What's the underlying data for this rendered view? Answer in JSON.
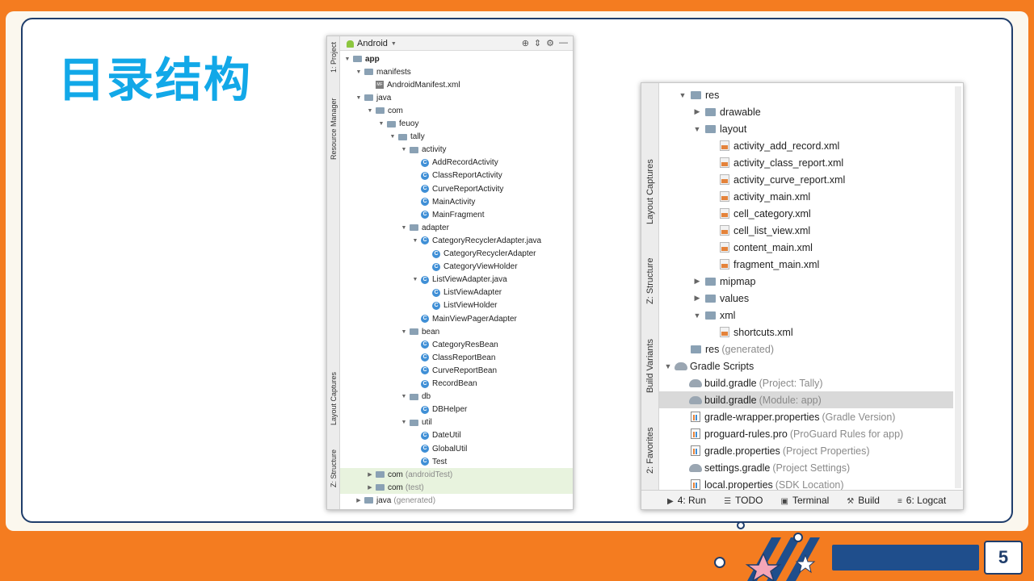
{
  "slide": {
    "title": "目录结构",
    "page_number": "5"
  },
  "panel1": {
    "selector_label": "Android",
    "side_tabs": [
      "1: Project",
      "Resource Manager",
      "Layout Captures",
      "Z: Structure"
    ],
    "tree": [
      {
        "level": 0,
        "twisty": "▼",
        "icon": "module",
        "label": "app",
        "bold": true
      },
      {
        "level": 1,
        "twisty": "▼",
        "icon": "folder",
        "label": "manifests"
      },
      {
        "level": 2,
        "twisty": "",
        "icon": "manifest",
        "label": "AndroidManifest.xml"
      },
      {
        "level": 1,
        "twisty": "▼",
        "icon": "folder",
        "label": "java"
      },
      {
        "level": 2,
        "twisty": "▼",
        "icon": "folder",
        "label": "com"
      },
      {
        "level": 3,
        "twisty": "▼",
        "icon": "folder",
        "label": "feuoy"
      },
      {
        "level": 4,
        "twisty": "▼",
        "icon": "folder",
        "label": "tally"
      },
      {
        "level": 5,
        "twisty": "▼",
        "icon": "folder",
        "label": "activity"
      },
      {
        "level": 6,
        "twisty": "",
        "icon": "class",
        "label": "AddRecordActivity"
      },
      {
        "level": 6,
        "twisty": "",
        "icon": "class",
        "label": "ClassReportActivity"
      },
      {
        "level": 6,
        "twisty": "",
        "icon": "class",
        "label": "CurveReportActivity"
      },
      {
        "level": 6,
        "twisty": "",
        "icon": "class",
        "label": "MainActivity"
      },
      {
        "level": 6,
        "twisty": "",
        "icon": "class",
        "label": "MainFragment"
      },
      {
        "level": 5,
        "twisty": "▼",
        "icon": "folder",
        "label": "adapter"
      },
      {
        "level": 6,
        "twisty": "▼",
        "icon": "class",
        "label": "CategoryRecyclerAdapter.java"
      },
      {
        "level": 7,
        "twisty": "",
        "icon": "class",
        "label": "CategoryRecyclerAdapter"
      },
      {
        "level": 7,
        "twisty": "",
        "icon": "class",
        "label": "CategoryViewHolder"
      },
      {
        "level": 6,
        "twisty": "▼",
        "icon": "class",
        "label": "ListViewAdapter.java"
      },
      {
        "level": 7,
        "twisty": "",
        "icon": "class",
        "label": "ListViewAdapter"
      },
      {
        "level": 7,
        "twisty": "",
        "icon": "class",
        "label": "ListViewHolder"
      },
      {
        "level": 6,
        "twisty": "",
        "icon": "class",
        "label": "MainViewPagerAdapter"
      },
      {
        "level": 5,
        "twisty": "▼",
        "icon": "folder",
        "label": "bean"
      },
      {
        "level": 6,
        "twisty": "",
        "icon": "class",
        "label": "CategoryResBean"
      },
      {
        "level": 6,
        "twisty": "",
        "icon": "class",
        "label": "ClassReportBean"
      },
      {
        "level": 6,
        "twisty": "",
        "icon": "class",
        "label": "CurveReportBean"
      },
      {
        "level": 6,
        "twisty": "",
        "icon": "class",
        "label": "RecordBean"
      },
      {
        "level": 5,
        "twisty": "▼",
        "icon": "folder",
        "label": "db"
      },
      {
        "level": 6,
        "twisty": "",
        "icon": "class",
        "label": "DBHelper"
      },
      {
        "level": 5,
        "twisty": "▼",
        "icon": "folder",
        "label": "util"
      },
      {
        "level": 6,
        "twisty": "",
        "icon": "class",
        "label": "DateUtil"
      },
      {
        "level": 6,
        "twisty": "",
        "icon": "class",
        "label": "GlobalUtil"
      },
      {
        "level": 6,
        "twisty": "",
        "icon": "class",
        "label": "Test"
      },
      {
        "level": 2,
        "twisty": "▶",
        "icon": "folder",
        "label": "com",
        "suffix": "(androidTest)",
        "highlight": true
      },
      {
        "level": 2,
        "twisty": "▶",
        "icon": "folder",
        "label": "com",
        "suffix": "(test)",
        "highlight": true
      },
      {
        "level": 1,
        "twisty": "▶",
        "icon": "folder",
        "label": "java",
        "suffix": "(generated)"
      }
    ]
  },
  "panel2": {
    "side_tabs": [
      "Layout Captures",
      "Z: Structure",
      "Build Variants",
      "2: Favorites"
    ],
    "tree": [
      {
        "level": 1,
        "twisty": "▼",
        "icon": "folder",
        "label": "res"
      },
      {
        "level": 2,
        "twisty": "▶",
        "icon": "folder",
        "label": "drawable"
      },
      {
        "level": 2,
        "twisty": "▼",
        "icon": "folder",
        "label": "layout"
      },
      {
        "level": 3,
        "twisty": "",
        "icon": "xml",
        "label": "activity_add_record.xml"
      },
      {
        "level": 3,
        "twisty": "",
        "icon": "xml",
        "label": "activity_class_report.xml"
      },
      {
        "level": 3,
        "twisty": "",
        "icon": "xml",
        "label": "activity_curve_report.xml"
      },
      {
        "level": 3,
        "twisty": "",
        "icon": "xml",
        "label": "activity_main.xml"
      },
      {
        "level": 3,
        "twisty": "",
        "icon": "xml",
        "label": "cell_category.xml"
      },
      {
        "level": 3,
        "twisty": "",
        "icon": "xml",
        "label": "cell_list_view.xml"
      },
      {
        "level": 3,
        "twisty": "",
        "icon": "xml",
        "label": "content_main.xml"
      },
      {
        "level": 3,
        "twisty": "",
        "icon": "xml",
        "label": "fragment_main.xml"
      },
      {
        "level": 2,
        "twisty": "▶",
        "icon": "folder",
        "label": "mipmap"
      },
      {
        "level": 2,
        "twisty": "▶",
        "icon": "folder",
        "label": "values"
      },
      {
        "level": 2,
        "twisty": "▼",
        "icon": "folder",
        "label": "xml"
      },
      {
        "level": 3,
        "twisty": "",
        "icon": "xml",
        "label": "shortcuts.xml"
      },
      {
        "level": 1,
        "twisty": "",
        "icon": "folder",
        "label": "res",
        "suffix": "(generated)"
      },
      {
        "level": 0,
        "twisty": "▼",
        "icon": "gradle",
        "label": "Gradle Scripts"
      },
      {
        "level": 1,
        "twisty": "",
        "icon": "gradle",
        "label": "build.gradle",
        "suffix": "(Project: Tally)"
      },
      {
        "level": 1,
        "twisty": "",
        "icon": "gradle",
        "label": "build.gradle",
        "suffix": "(Module: app)",
        "selected": true
      },
      {
        "level": 1,
        "twisty": "",
        "icon": "props",
        "label": "gradle-wrapper.properties",
        "suffix": "(Gradle Version)"
      },
      {
        "level": 1,
        "twisty": "",
        "icon": "props",
        "label": "proguard-rules.pro",
        "suffix": "(ProGuard Rules for app)"
      },
      {
        "level": 1,
        "twisty": "",
        "icon": "props",
        "label": "gradle.properties",
        "suffix": "(Project Properties)"
      },
      {
        "level": 1,
        "twisty": "",
        "icon": "gradle",
        "label": "settings.gradle",
        "suffix": "(Project Settings)"
      },
      {
        "level": 1,
        "twisty": "",
        "icon": "props",
        "label": "local.properties",
        "suffix": "(SDK Location)"
      }
    ],
    "bottom_tabs": [
      {
        "icon": "▶",
        "label": "4: Run"
      },
      {
        "icon": "☰",
        "label": "TODO"
      },
      {
        "icon": "▣",
        "label": "Terminal"
      },
      {
        "icon": "⚒",
        "label": "Build"
      },
      {
        "icon": "≡",
        "label": "6: Logcat"
      }
    ]
  },
  "colors": {
    "background_orange": "#f47c20",
    "title_blue": "#12a8e8",
    "border_navy": "#1f3d6b"
  }
}
